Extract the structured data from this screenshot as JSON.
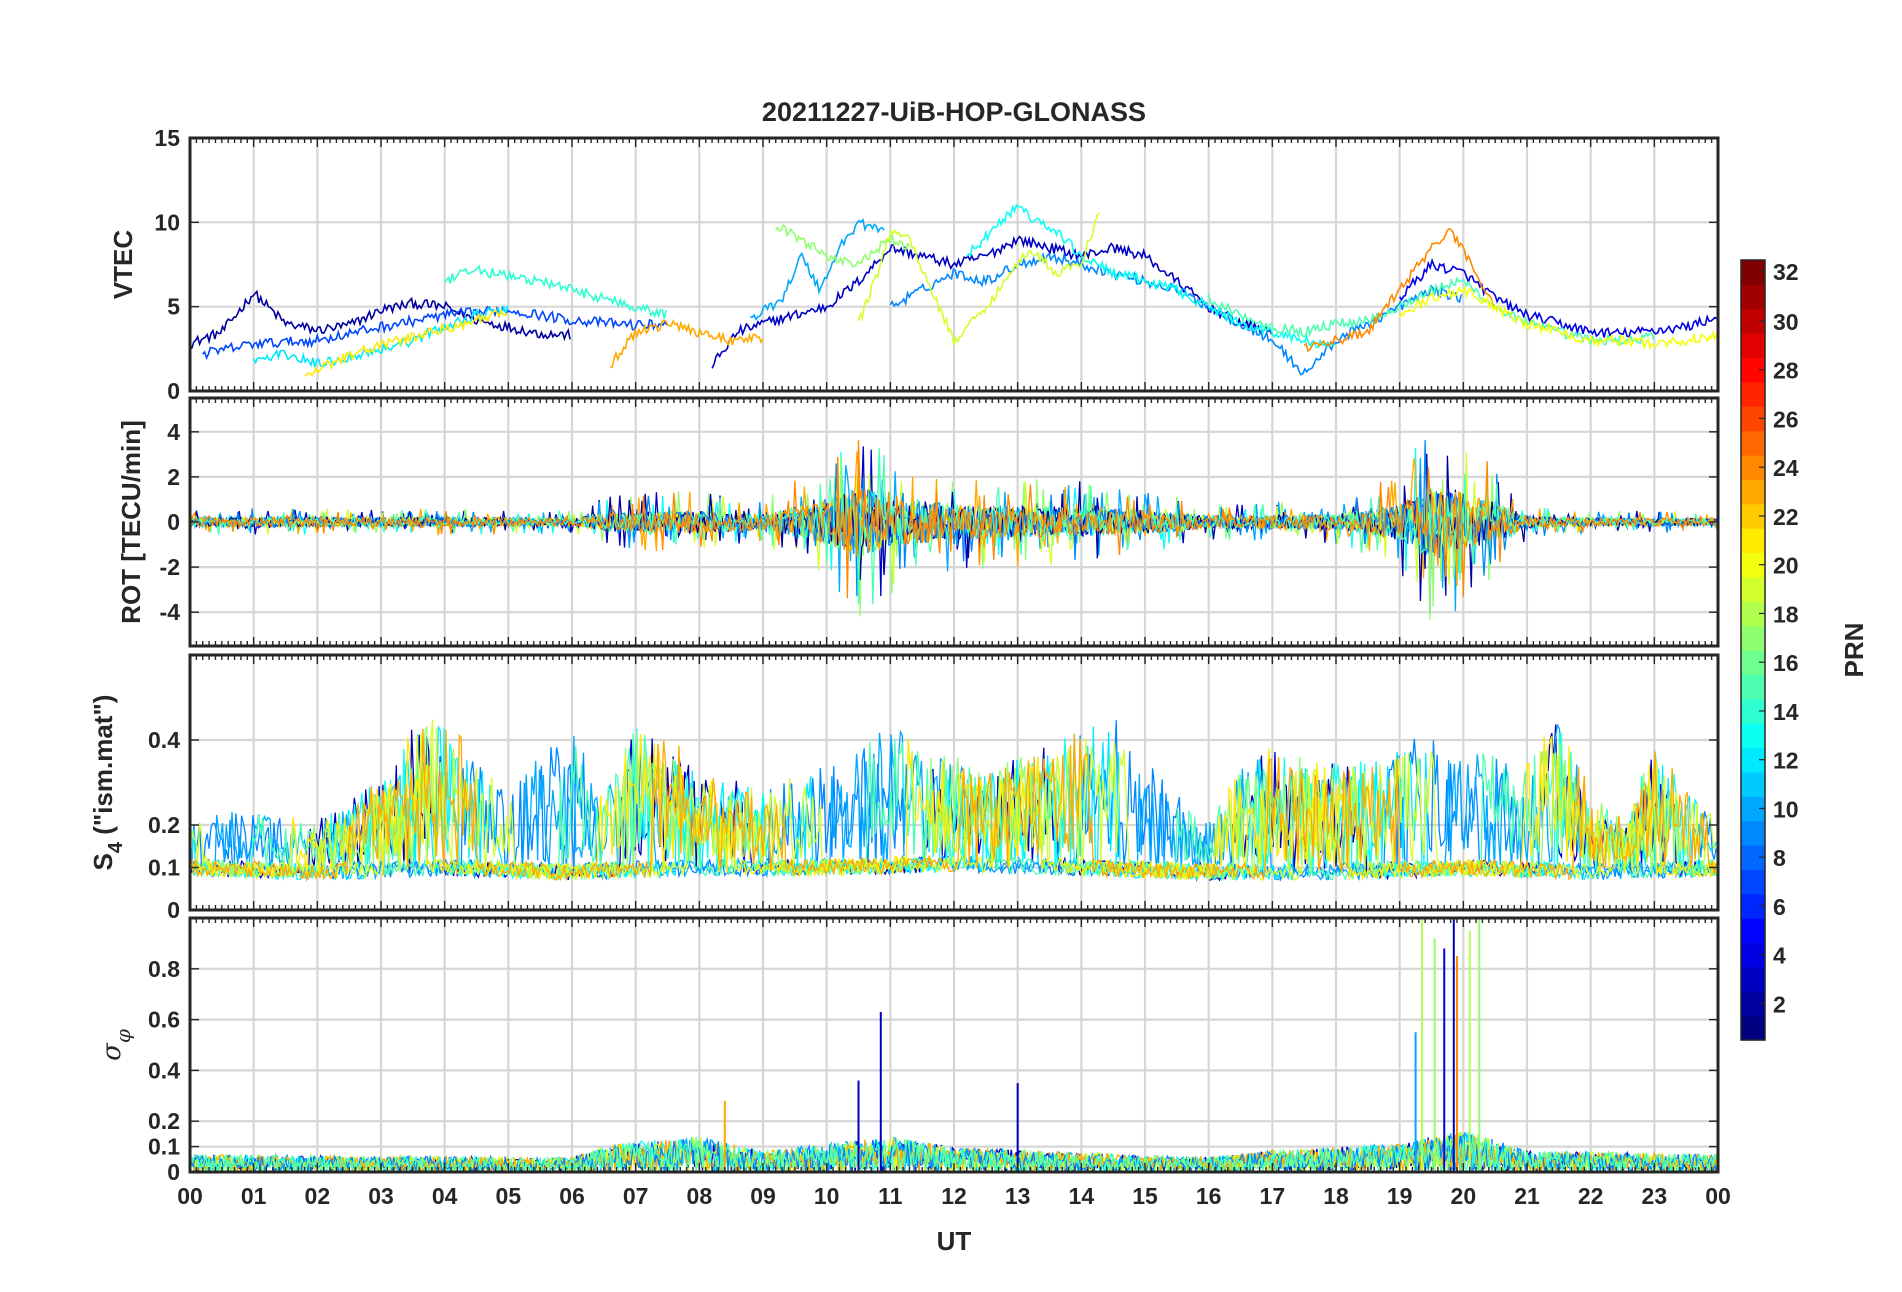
{
  "chart_data": {
    "type": "line",
    "title": "20211227-UiB-HOP-GLONASS",
    "xlabel": "UT",
    "x_tick_labels": [
      "00",
      "01",
      "02",
      "03",
      "04",
      "05",
      "06",
      "07",
      "08",
      "09",
      "10",
      "11",
      "12",
      "13",
      "14",
      "15",
      "16",
      "17",
      "18",
      "19",
      "20",
      "21",
      "22",
      "23",
      "00"
    ],
    "xlim": [
      0,
      24
    ],
    "grid": true,
    "panels": [
      {
        "id": "vtec",
        "ylabel": "VTEC",
        "ylim": [
          0,
          15
        ],
        "y_ticks": [
          0,
          5,
          10,
          15
        ],
        "y_tick_labels": [
          "0",
          "5",
          "10",
          "15"
        ],
        "series": [
          {
            "prn": 2,
            "x": [
              0,
              0.5,
              1,
              1.5,
              2,
              2.5,
              3,
              3.5,
              4,
              4.5,
              5,
              5.5,
              6
            ],
            "values": [
              2.8,
              3.5,
              5.8,
              4.0,
              3.6,
              3.9,
              4.8,
              5.2,
              5.0,
              4.2,
              3.8,
              3.4,
              3.3
            ]
          },
          {
            "prn": 3,
            "x": [
              8.2,
              8.6,
              9,
              9.5,
              10,
              10.5,
              11,
              11.5,
              12,
              12.5,
              13,
              13.5,
              14,
              14.5,
              15,
              15.5,
              16,
              16.5,
              17
            ],
            "values": [
              1.5,
              3.5,
              4.0,
              4.5,
              5.0,
              6.5,
              8.5,
              8.0,
              7.5,
              8.0,
              9.0,
              8.5,
              8.0,
              8.5,
              8.0,
              6.5,
              5.0,
              4.0,
              3.5
            ]
          },
          {
            "prn": 4,
            "x": [
              19,
              19.5,
              20,
              20.5,
              21,
              21.5,
              22,
              22.5,
              23,
              23.5,
              24
            ],
            "values": [
              5.5,
              7.5,
              7.0,
              5.5,
              4.5,
              4.0,
              3.5,
              3.4,
              3.6,
              3.8,
              4.4
            ]
          },
          {
            "prn": 7,
            "x": [
              0.2,
              1,
              2,
              3,
              4,
              5,
              6,
              7,
              7.5
            ],
            "values": [
              2.2,
              2.8,
              3.0,
              3.8,
              4.5,
              4.8,
              4.2,
              3.9,
              4.0
            ]
          },
          {
            "prn": 9,
            "x": [
              11,
              11.5,
              12,
              12.5,
              13,
              13.5,
              14,
              14.5,
              15,
              15.5,
              16,
              16.5,
              17,
              17.5,
              18,
              18.5,
              19,
              19.5,
              20
            ],
            "values": [
              5.0,
              6.0,
              7.0,
              6.5,
              7.5,
              8.0,
              7.5,
              7.0,
              6.5,
              6.0,
              5.0,
              4.0,
              3.0,
              1.0,
              3.0,
              4.0,
              5.0,
              6.0,
              5.5
            ]
          },
          {
            "prn": 10,
            "x": [
              8.8,
              9.3,
              9.6,
              9.9,
              10.2,
              10.5,
              10.9
            ],
            "values": [
              4.2,
              5.5,
              8.0,
              6.0,
              8.5,
              10.0,
              9.5
            ]
          },
          {
            "prn": 12,
            "x": [
              1,
              1.5,
              2,
              2.5,
              3,
              3.5,
              4,
              4.5,
              5
            ],
            "values": [
              1.8,
              2.2,
              1.6,
              2.0,
              2.5,
              3.0,
              3.8,
              4.5,
              4.8
            ]
          },
          {
            "prn": 13,
            "x": [
              12.2,
              12.6,
              13,
              13.3,
              13.6,
              14,
              14.5,
              15,
              15.5,
              16,
              16.5,
              17,
              17.5,
              18
            ],
            "values": [
              8.0,
              9.5,
              11.0,
              10.0,
              9.5,
              8.0,
              7.0,
              6.5,
              6.0,
              5.0,
              4.0,
              3.5,
              3.0,
              2.5
            ]
          },
          {
            "prn": 14,
            "x": [
              4,
              4.5,
              5,
              5.5,
              6,
              6.5,
              7,
              7.5
            ],
            "values": [
              6.5,
              7.2,
              6.8,
              6.5,
              6.0,
              5.5,
              5.0,
              4.5
            ]
          },
          {
            "prn": 15,
            "x": [
              16,
              16.5,
              17,
              17.5,
              18,
              18.5,
              19,
              19.5,
              20,
              20.5,
              21,
              21.5,
              22,
              22.5,
              23
            ],
            "values": [
              5.5,
              4.5,
              3.8,
              3.5,
              4.0,
              4.2,
              5.0,
              6.0,
              6.5,
              5.0,
              4.0,
              3.5,
              3.0,
              3.0,
              3.2
            ]
          },
          {
            "prn": 17,
            "x": [
              9.2,
              9.6,
              10,
              10.5,
              11,
              11.3
            ],
            "values": [
              9.8,
              9.0,
              8.0,
              7.5,
              9.0,
              8.5
            ]
          },
          {
            "prn": 19,
            "x": [
              10.5,
              10.8,
              11,
              11.3,
              11.7,
              12,
              12.4,
              12.8,
              13.2,
              13.6,
              14,
              14.3
            ],
            "values": [
              4.0,
              7.0,
              9.5,
              9.0,
              5.5,
              3.0,
              4.5,
              6.5,
              8.5,
              7.0,
              7.5,
              11.0
            ]
          },
          {
            "prn": 21,
            "x": [
              1.8,
              2.3,
              2.8,
              3.3,
              3.8,
              4.3,
              4.8,
              5
            ],
            "values": [
              0.8,
              1.8,
              2.5,
              3.0,
              3.5,
              4.0,
              4.5,
              4.5
            ]
          },
          {
            "prn": 23,
            "x": [
              6.6,
              7,
              7.5,
              8,
              8.5,
              9
            ],
            "values": [
              1.5,
              3.5,
              4.0,
              3.5,
              3.0,
              3.2
            ]
          },
          {
            "prn": 24,
            "x": [
              17.5,
              18,
              18.5,
              19,
              19.5,
              19.8,
              20.2,
              20.5
            ],
            "values": [
              2.5,
              3.0,
              3.5,
              6.0,
              8.5,
              9.5,
              7.0,
              5.0
            ]
          },
          {
            "prn": 20,
            "x": [
              19,
              19.5,
              20,
              20.5,
              21,
              21.5,
              22,
              22.5,
              23,
              23.5,
              24
            ],
            "values": [
              4.5,
              5.5,
              6.0,
              5.0,
              4.0,
              3.5,
              3.0,
              3.0,
              2.8,
              3.0,
              3.2
            ]
          }
        ]
      },
      {
        "id": "rot",
        "ylabel": "ROT [TECU/min]",
        "ylim": [
          -5.5,
          5.5
        ],
        "y_ticks": [
          -4,
          -2,
          0,
          2,
          4
        ],
        "y_tick_labels": [
          "-4",
          "-2",
          "0",
          "2",
          "4"
        ],
        "series": []
      },
      {
        "id": "s4",
        "ylabel": "S4 (\"ism.mat\")",
        "ylabel_main": "S",
        "ylabel_sub": "4",
        "ylabel_rest": " (\"ism.mat\")",
        "ylim": [
          0,
          0.6
        ],
        "y_ticks": [
          0,
          0.1,
          0.2,
          0.4
        ],
        "y_tick_labels": [
          "0",
          "0.1",
          "0.2",
          "0.4"
        ],
        "series": []
      },
      {
        "id": "sigma",
        "ylabel": "σφ",
        "ylabel_main": "σ",
        "ylabel_sub": "φ",
        "ylim": [
          0,
          1.0
        ],
        "y_ticks": [
          0,
          0.1,
          0.2,
          0.4,
          0.6,
          0.8
        ],
        "y_tick_labels": [
          "0",
          "0.1",
          "0.2",
          "0.4",
          "0.6",
          "0.8"
        ],
        "series": []
      }
    ],
    "colorbar": {
      "label": "PRN",
      "colormap": "jet",
      "range": [
        1,
        32
      ],
      "tick_values": [
        2,
        4,
        6,
        8,
        10,
        12,
        14,
        16,
        18,
        20,
        22,
        24,
        26,
        28,
        30,
        32
      ],
      "tick_labels": [
        "2",
        "4",
        "6",
        "8",
        "10",
        "12",
        "14",
        "16",
        "18",
        "20",
        "22",
        "24",
        "26",
        "28",
        "30",
        "32"
      ]
    },
    "activity": {
      "rot_envelope": {
        "x": [
          0,
          2,
          4,
          6,
          6.6,
          7,
          8,
          9,
          10,
          10.5,
          11,
          12,
          13,
          14,
          15,
          16,
          17,
          18,
          19,
          19.5,
          20,
          20.5,
          21,
          22,
          23,
          24
        ],
        "amplitude": [
          0.6,
          0.6,
          0.6,
          0.5,
          1.2,
          1.3,
          1.4,
          1.0,
          2.8,
          4.5,
          3.2,
          2.2,
          2.0,
          1.8,
          1.5,
          0.8,
          0.9,
          1.0,
          2.2,
          4.5,
          3.8,
          2.5,
          0.8,
          0.5,
          0.5,
          0.5
        ]
      },
      "s4_baseline": {
        "x": [
          0,
          2,
          4,
          6,
          8,
          10,
          12,
          14,
          16,
          18,
          20,
          22,
          24
        ],
        "values": [
          0.08,
          0.07,
          0.08,
          0.07,
          0.08,
          0.08,
          0.09,
          0.08,
          0.07,
          0.07,
          0.08,
          0.07,
          0.08
        ]
      },
      "s4_envelope": {
        "x": [
          0,
          1,
          2,
          3,
          3.5,
          4,
          4.5,
          5,
          5.5,
          6,
          6.5,
          7,
          7.5,
          8,
          9,
          10,
          11,
          12,
          12.5,
          13,
          14,
          14.5,
          15,
          16,
          16.5,
          17,
          18,
          19,
          19.5,
          20,
          21,
          21.5,
          22,
          22.5,
          23,
          24
        ],
        "amplitude": [
          0.15,
          0.2,
          0.15,
          0.3,
          0.45,
          0.5,
          0.35,
          0.25,
          0.4,
          0.45,
          0.25,
          0.5,
          0.45,
          0.3,
          0.25,
          0.35,
          0.45,
          0.35,
          0.3,
          0.35,
          0.45,
          0.5,
          0.35,
          0.15,
          0.35,
          0.4,
          0.35,
          0.4,
          0.45,
          0.4,
          0.35,
          0.5,
          0.25,
          0.15,
          0.4,
          0.15
        ]
      },
      "sigma_baseline": {
        "x": [
          0,
          6,
          6.6,
          8,
          9,
          10,
          11,
          12,
          16,
          17,
          19,
          20,
          21,
          24
        ],
        "values": [
          0.05,
          0.04,
          0.08,
          0.1,
          0.06,
          0.08,
          0.1,
          0.07,
          0.04,
          0.06,
          0.08,
          0.12,
          0.06,
          0.05
        ]
      },
      "sigma_spikes": [
        {
          "x": 10.85,
          "value": 0.63,
          "prn": 3
        },
        {
          "x": 10.5,
          "value": 0.36,
          "prn": 3
        },
        {
          "x": 13.0,
          "value": 0.35,
          "prn": 3
        },
        {
          "x": 8.4,
          "value": 0.28,
          "prn": 23
        },
        {
          "x": 19.35,
          "value": 1.0,
          "prn": 18
        },
        {
          "x": 19.25,
          "value": 0.55,
          "prn": 10
        },
        {
          "x": 19.55,
          "value": 0.92,
          "prn": 17
        },
        {
          "x": 19.7,
          "value": 0.88,
          "prn": 4
        },
        {
          "x": 19.85,
          "value": 1.0,
          "prn": 3
        },
        {
          "x": 19.9,
          "value": 0.85,
          "prn": 24
        },
        {
          "x": 20.1,
          "value": 0.95,
          "prn": 18
        },
        {
          "x": 20.25,
          "value": 1.0,
          "prn": 17
        }
      ]
    }
  }
}
